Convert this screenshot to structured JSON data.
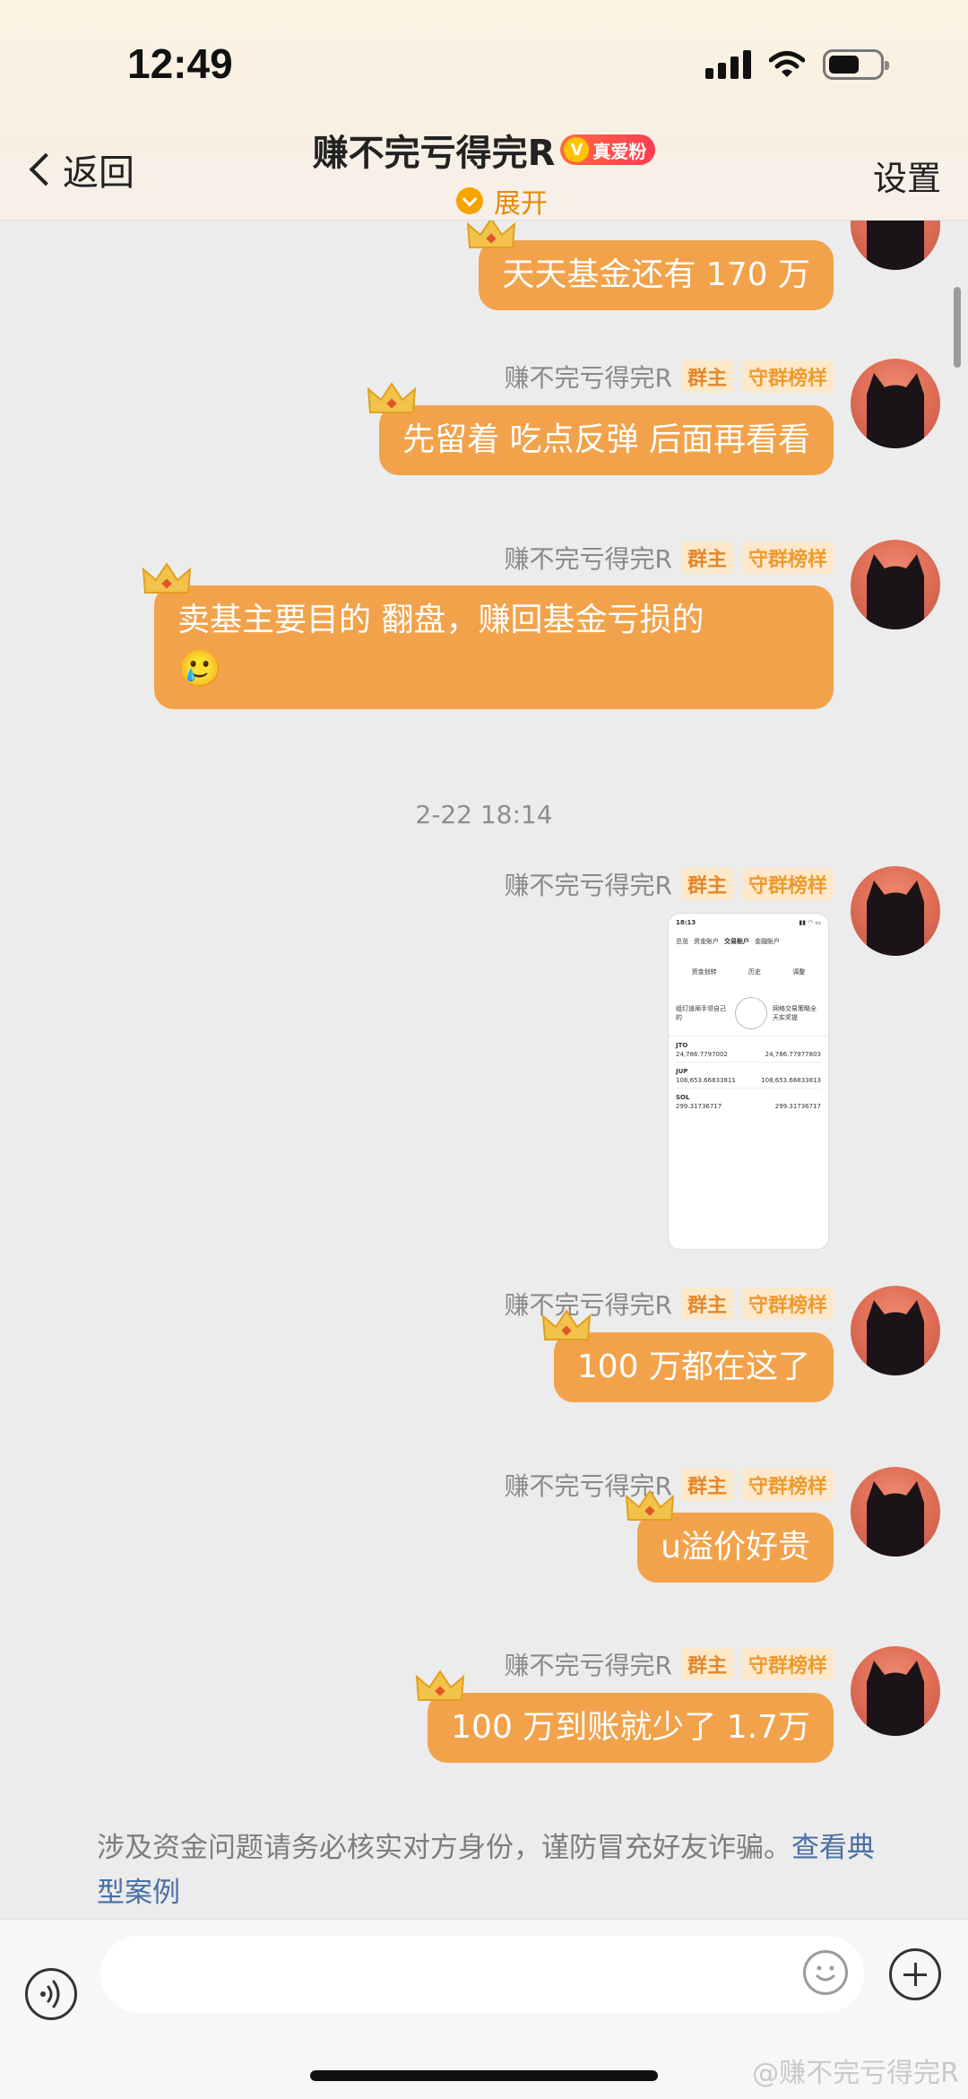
{
  "status_bar": {
    "time": "12:49"
  },
  "nav": {
    "back_label": "返回",
    "title": "赚不完亏得完R",
    "badge": "真爱粉",
    "badge_icon": "V",
    "expand_label": "展开",
    "settings_label": "设置"
  },
  "tags": {
    "owner": "群主",
    "model": "守群榜样"
  },
  "sender_name": "赚不完亏得完R",
  "messages": [
    {
      "text": "天天基金还有 170 万"
    },
    {
      "text": "先留着 吃点反弹 后面再看看"
    },
    {
      "text": "卖基主要目的 翻盘，赚回基金亏损的",
      "emoji": "🥲"
    },
    {
      "text": "100 万都在这了"
    },
    {
      "text": "u溢价好贵"
    },
    {
      "text": "100 万到账就少了 1.7万"
    }
  ],
  "timestamp": "2-22 18:14",
  "screenshot_thumb": {
    "time": "18:13",
    "tabs": [
      "总览",
      "资金账户",
      "交易账户",
      "金融账户"
    ],
    "actions": [
      "资金划转",
      "历史",
      "调整"
    ],
    "banner_left": "组灯道阐手领自己的",
    "banner_right": "网格交易策略全天实奖提",
    "coins": [
      {
        "name": "JTO",
        "amount": "24,786.7797002",
        "value": "24,786.77977803"
      },
      {
        "name": "JUP",
        "amount": "108,653.66833811",
        "value": "108,653.66833813"
      },
      {
        "name": "SOL",
        "amount": "299.31736717",
        "value": "299.31736717"
      }
    ]
  },
  "notice": {
    "text": "涉及资金问题请务必核实对方身份，谨防冒充好友诈骗。",
    "link": "查看典型案例"
  },
  "input": {
    "placeholder": ""
  },
  "watermark": "@赚不完亏得完R",
  "colors": {
    "bubble": "#f2a24a",
    "accent": "#e58a00",
    "link": "#4a6fa5"
  }
}
